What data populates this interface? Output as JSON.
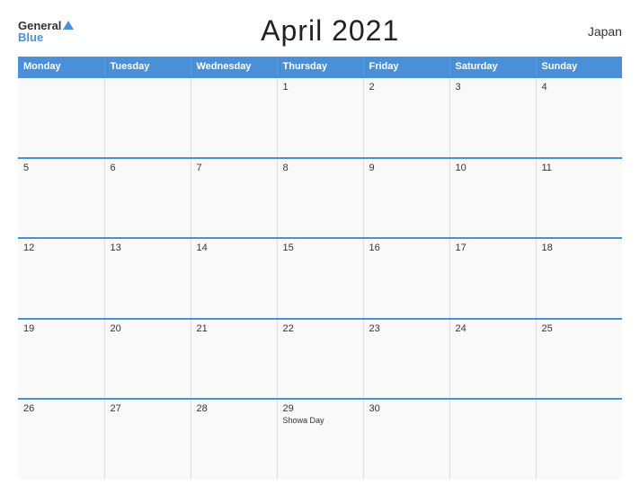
{
  "header": {
    "logo_general": "General",
    "logo_blue": "Blue",
    "month_title": "April 2021",
    "country": "Japan"
  },
  "calendar": {
    "columns": [
      "Monday",
      "Tuesday",
      "Wednesday",
      "Thursday",
      "Friday",
      "Saturday",
      "Sunday"
    ],
    "rows": [
      [
        {
          "num": "",
          "event": ""
        },
        {
          "num": "",
          "event": ""
        },
        {
          "num": "",
          "event": ""
        },
        {
          "num": "1",
          "event": ""
        },
        {
          "num": "2",
          "event": ""
        },
        {
          "num": "3",
          "event": ""
        },
        {
          "num": "4",
          "event": ""
        }
      ],
      [
        {
          "num": "5",
          "event": ""
        },
        {
          "num": "6",
          "event": ""
        },
        {
          "num": "7",
          "event": ""
        },
        {
          "num": "8",
          "event": ""
        },
        {
          "num": "9",
          "event": ""
        },
        {
          "num": "10",
          "event": ""
        },
        {
          "num": "11",
          "event": ""
        }
      ],
      [
        {
          "num": "12",
          "event": ""
        },
        {
          "num": "13",
          "event": ""
        },
        {
          "num": "14",
          "event": ""
        },
        {
          "num": "15",
          "event": ""
        },
        {
          "num": "16",
          "event": ""
        },
        {
          "num": "17",
          "event": ""
        },
        {
          "num": "18",
          "event": ""
        }
      ],
      [
        {
          "num": "19",
          "event": ""
        },
        {
          "num": "20",
          "event": ""
        },
        {
          "num": "21",
          "event": ""
        },
        {
          "num": "22",
          "event": ""
        },
        {
          "num": "23",
          "event": ""
        },
        {
          "num": "24",
          "event": ""
        },
        {
          "num": "25",
          "event": ""
        }
      ],
      [
        {
          "num": "26",
          "event": ""
        },
        {
          "num": "27",
          "event": ""
        },
        {
          "num": "28",
          "event": ""
        },
        {
          "num": "29",
          "event": "Showa Day"
        },
        {
          "num": "30",
          "event": ""
        },
        {
          "num": "",
          "event": ""
        },
        {
          "num": "",
          "event": ""
        }
      ]
    ]
  }
}
